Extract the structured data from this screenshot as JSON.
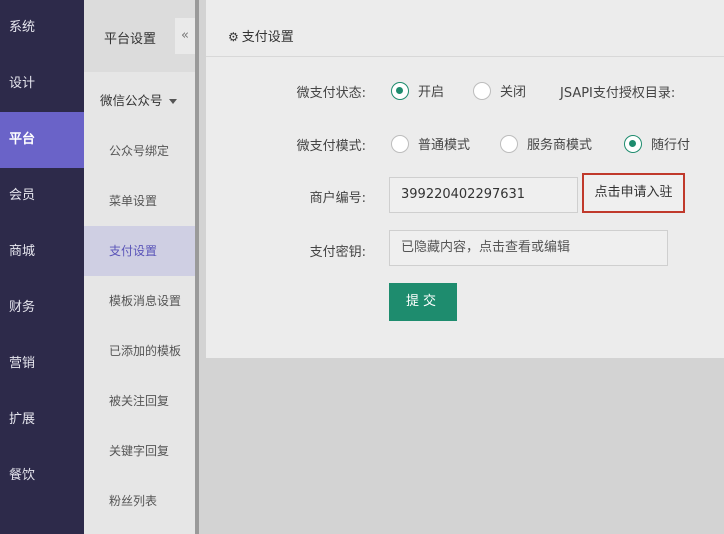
{
  "nav": {
    "items": [
      {
        "label": "系统"
      },
      {
        "label": "设计"
      },
      {
        "label": "平台"
      },
      {
        "label": "会员"
      },
      {
        "label": "商城"
      },
      {
        "label": "财务"
      },
      {
        "label": "营销"
      },
      {
        "label": "扩展"
      },
      {
        "label": "餐饮"
      }
    ]
  },
  "sidebar": {
    "title": "平台设置",
    "collapse_icon": "«",
    "group": "微信公众号",
    "items": [
      {
        "label": "公众号绑定"
      },
      {
        "label": "菜单设置"
      },
      {
        "label": "支付设置"
      },
      {
        "label": "模板消息设置"
      },
      {
        "label": "已添加的模板"
      },
      {
        "label": "被关注回复"
      },
      {
        "label": "关键字回复"
      },
      {
        "label": "粉丝列表"
      }
    ]
  },
  "panel": {
    "title": "支付设置",
    "title_icon": "⚙",
    "status_label": "微支付状态:",
    "status_options": [
      {
        "label": "开启",
        "checked": true
      },
      {
        "label": "关闭",
        "checked": false
      }
    ],
    "jsapi_label": "JSAPI支付授权目录:",
    "mode_label": "微支付模式:",
    "mode_options": [
      {
        "label": "普通模式",
        "checked": false
      },
      {
        "label": "服务商模式",
        "checked": false
      },
      {
        "label": "随行付",
        "checked": true
      }
    ],
    "merchant_label": "商户编号:",
    "merchant_value": "399220402297631",
    "apply_button": "点击申请入驻",
    "secret_label": "支付密钥:",
    "secret_value": "已隐藏内容，点击查看或编辑",
    "submit_button": "提交"
  },
  "colors": {
    "nav_bg": "#2d2a4a",
    "nav_active": "#6a63c8",
    "accent_green": "#1e8c6e",
    "highlight_red": "#c0392b"
  }
}
